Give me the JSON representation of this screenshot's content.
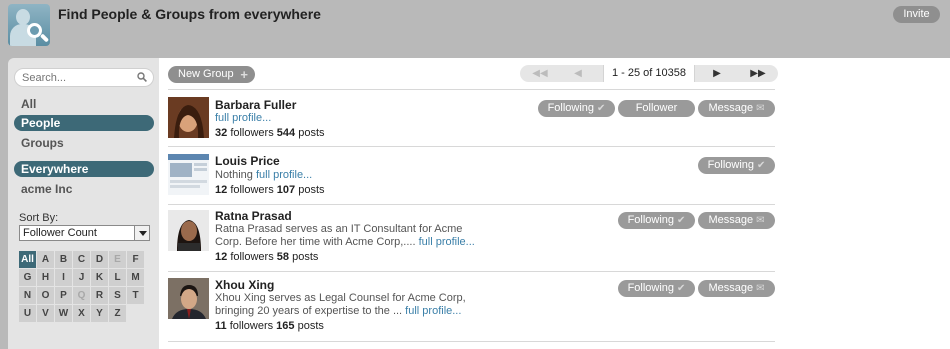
{
  "header": {
    "title": "Find People & Groups from everywhere",
    "invite_label": "Invite"
  },
  "sidebar": {
    "search_placeholder": "Search...",
    "filters": [
      "All",
      "People",
      "Groups"
    ],
    "active_filter": "People",
    "scopes": [
      "Everywhere",
      "acme Inc"
    ],
    "active_scope": "Everywhere",
    "sort_label": "Sort By:",
    "sort_value": "Follower Count",
    "letters": [
      "All",
      "A",
      "B",
      "C",
      "D",
      "E",
      "F",
      "G",
      "H",
      "I",
      "J",
      "K",
      "L",
      "M",
      "N",
      "O",
      "P",
      "Q",
      "R",
      "S",
      "T",
      "U",
      "V",
      "W",
      "X",
      "Y",
      "Z"
    ],
    "selected_letter": "All",
    "dim_letters": [
      "E",
      "Q"
    ]
  },
  "toolbar": {
    "new_group_label": "New Group",
    "pager_range": "1 - 25 of 10358"
  },
  "people": [
    {
      "name": "Barbara Fuller",
      "description": "",
      "link": "full profile...",
      "followers": "32",
      "followers_label": "followers",
      "posts": "544",
      "posts_label": "posts",
      "buttons": [
        "Following",
        "Follower",
        "Message"
      ]
    },
    {
      "name": "Louis Price",
      "description": "Nothing",
      "link": "full profile...",
      "followers": "12",
      "followers_label": "followers",
      "posts": "107",
      "posts_label": "posts",
      "buttons": [
        "Following"
      ]
    },
    {
      "name": "Ratna Prasad",
      "description": "Ratna Prasad serves as an IT Consultant for Acme Corp. Before her time with Acme Corp,....",
      "link": "full profile...",
      "followers": "12",
      "followers_label": "followers",
      "posts": "58",
      "posts_label": "posts",
      "buttons": [
        "Following",
        "Message"
      ]
    },
    {
      "name": "Xhou Xing",
      "description": "Xhou Xing serves as Legal Counsel for Acme Corp, bringing 20 years of expertise to the ...",
      "link": "full profile...",
      "followers": "11",
      "followers_label": "followers",
      "posts": "165",
      "posts_label": "posts",
      "buttons": [
        "Following",
        "Message"
      ]
    }
  ]
}
